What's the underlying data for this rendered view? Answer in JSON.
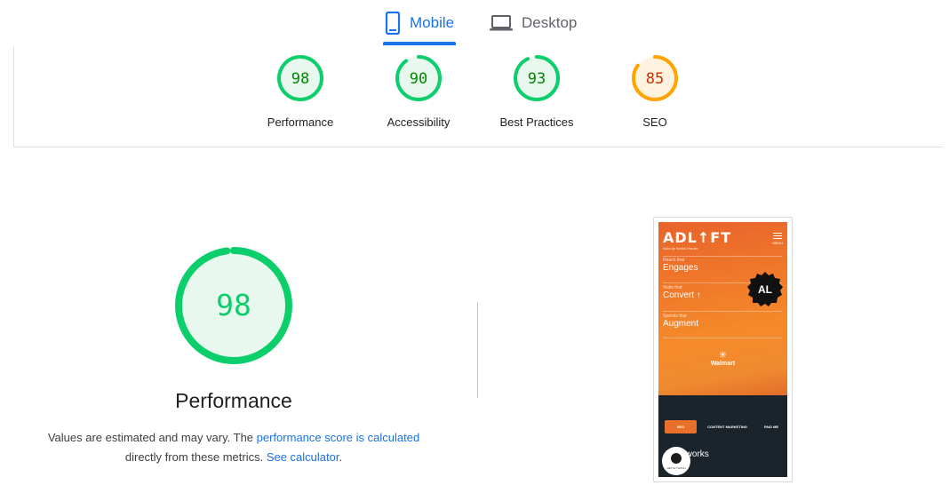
{
  "tabs": [
    {
      "label": "Mobile",
      "icon": "smartphone-icon",
      "active": true
    },
    {
      "label": "Desktop",
      "icon": "laptop-icon",
      "active": false
    }
  ],
  "scores": [
    {
      "value": "98",
      "label": "Performance",
      "fraction": 0.98,
      "ring": "#0cce6b",
      "fill": "#e8f8ee",
      "text": "#008800"
    },
    {
      "value": "90",
      "label": "Accessibility",
      "fraction": 0.9,
      "ring": "#0cce6b",
      "fill": "#e8f8ee",
      "text": "#008800"
    },
    {
      "value": "93",
      "label": "Best Practices",
      "fraction": 0.93,
      "ring": "#0cce6b",
      "fill": "#e8f8ee",
      "text": "#008800"
    },
    {
      "value": "85",
      "label": "SEO",
      "fraction": 0.85,
      "ring": "#ffa400",
      "fill": "#fff3e0",
      "text": "#c33300"
    }
  ],
  "main_score": {
    "value": "98",
    "label": "Performance",
    "fraction": 0.98,
    "ring": "#0cce6b",
    "fill": "#e8f8ee",
    "text": "#0cce6b"
  },
  "note": {
    "prefix": "Values are estimated and may vary. The ",
    "link1": "performance score is calculated",
    "middle": "directly from these metrics. ",
    "link2": "See calculator",
    "suffix": "."
  },
  "preview": {
    "logo": "ADL↑FT",
    "tagline": "Nobody Works Harder",
    "menu": "MENU",
    "rows": [
      {
        "small": "Reach that",
        "big": "Engages"
      },
      {
        "small": "Visits that",
        "big": "Convert ↑"
      },
      {
        "small": "Spends that",
        "big": "Augment"
      }
    ],
    "badge": "AL",
    "walmart_mark": "✳",
    "walmart": "Walmart",
    "pills": [
      "SEO",
      "CONTENT MARKETING",
      "PAID ME"
    ],
    "heading": "hat works",
    "chat_label": "GET IN TOUCH"
  }
}
